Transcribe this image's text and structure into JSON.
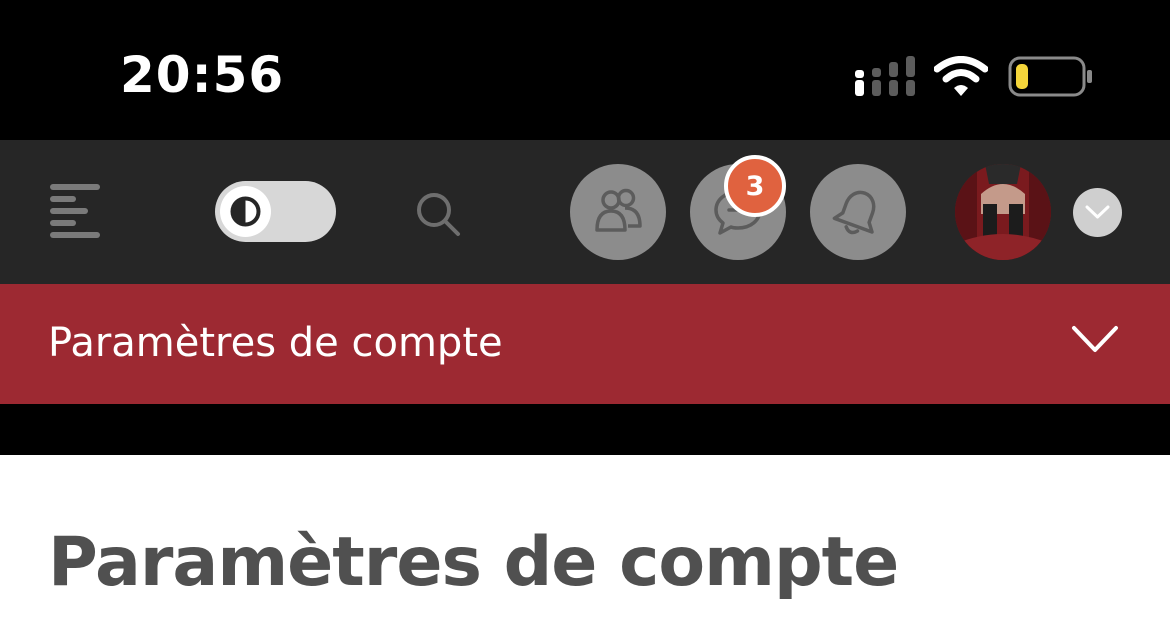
{
  "status_bar": {
    "time": "20:56",
    "signal_icon": "cellular-signal-icon",
    "wifi_icon": "wifi-icon",
    "battery_icon": "battery-low-icon",
    "battery_level": 0.15
  },
  "navbar": {
    "menu_icon": "hamburger-menu-icon",
    "theme_toggle_icon": "contrast-icon",
    "search_icon": "search-icon",
    "friends_icon": "users-icon",
    "messages_icon": "chat-bubble-icon",
    "messages_count": "3",
    "notifications_icon": "bell-icon",
    "dropdown_icon": "chevron-down-icon"
  },
  "section": {
    "title": "Paramètres de compte",
    "chevron_icon": "chevron-down-icon"
  },
  "page": {
    "heading": "Paramètres de compte"
  },
  "colors": {
    "status_bar": "#000000",
    "navbar": "#262626",
    "section_bar": "#9d2932",
    "badge": "#e0623f",
    "icon_button": "#8c8c8c",
    "heading": "#505050"
  }
}
